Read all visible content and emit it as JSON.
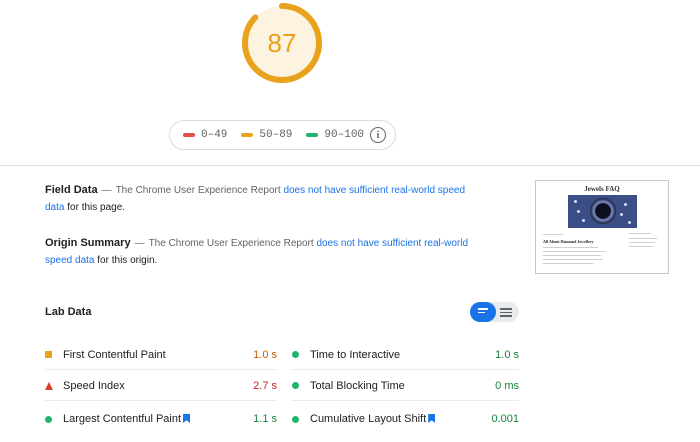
{
  "score": {
    "value": "87",
    "fraction": 0.87,
    "color": "#e8a21b",
    "track_color": "#fdf3e1"
  },
  "legend": {
    "items": [
      {
        "range": "0–49",
        "color": "#e0514a"
      },
      {
        "range": "50–89",
        "color": "#e8a21b"
      },
      {
        "range": "90–100",
        "color": "#1eb46a"
      }
    ],
    "info_icon": "info-icon",
    "info_glyph": "i"
  },
  "field_data": {
    "title": "Field Data",
    "dash": "—",
    "text": "The Chrome User Experience Report",
    "link": "does not have sufficient real-world speed data",
    "tail": "for this page."
  },
  "origin_summary": {
    "title": "Origin Summary",
    "dash": "—",
    "text": "The Chrome User Experience Report",
    "link": "does not have sufficient real-world speed data",
    "tail": "for this origin."
  },
  "thumbnail": {
    "site_title": "Jewels FAQ",
    "heading": "All About Diamond Jewellery"
  },
  "lab_data": {
    "title": "Lab Data",
    "view_toggle": {
      "selected": "list-view"
    },
    "metrics_left": [
      {
        "name": "First Contentful Paint",
        "value": "1.0 s",
        "status": "average",
        "marker": "square"
      },
      {
        "name": "Speed Index",
        "value": "2.7 s",
        "status": "fail",
        "marker": "triangle"
      },
      {
        "name": "Largest Contentful Paint",
        "value": "1.1 s",
        "status": "pass",
        "marker": "circle",
        "bookmark": true
      }
    ],
    "metrics_right": [
      {
        "name": "Time to Interactive",
        "value": "1.0 s",
        "status": "pass",
        "marker": "circle"
      },
      {
        "name": "Total Blocking Time",
        "value": "0 ms",
        "status": "pass",
        "marker": "circle"
      },
      {
        "name": "Cumulative Layout Shift",
        "value": "0.001",
        "status": "pass",
        "marker": "circle",
        "bookmark": true
      }
    ]
  }
}
